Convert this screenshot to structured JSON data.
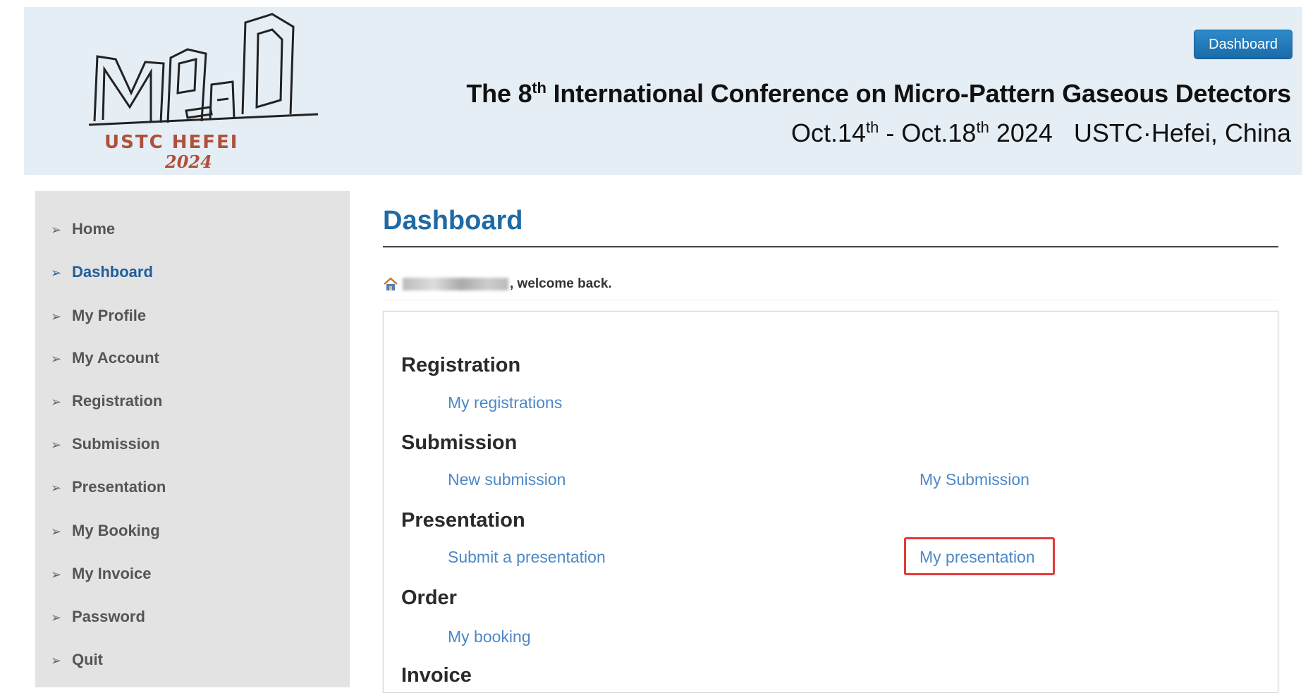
{
  "header": {
    "logo": {
      "letters": "MPGD",
      "place": "USTC HEFEI",
      "year": "2024"
    },
    "dashboard_button": "Dashboard",
    "title": {
      "pre": "The 8",
      "sup": "th",
      "post": " International Conference on Micro-Pattern Gaseous Detectors"
    },
    "dates": {
      "start": "Oct.14",
      "start_sup": "th",
      "sep": " - Oct.18",
      "end_sup": "th",
      "rest": " 2024   USTC·Hefei, China"
    }
  },
  "sidebar": {
    "items": [
      {
        "label": "Home"
      },
      {
        "label": "Dashboard",
        "active": true
      },
      {
        "label": "My Profile"
      },
      {
        "label": "My Account"
      },
      {
        "label": "Registration"
      },
      {
        "label": "Submission"
      },
      {
        "label": "Presentation"
      },
      {
        "label": "My Booking"
      },
      {
        "label": "My Invoice"
      },
      {
        "label": "Password"
      },
      {
        "label": "Quit"
      }
    ]
  },
  "main": {
    "title": "Dashboard",
    "welcome": ", welcome back.",
    "sections": {
      "registration": {
        "heading": "Registration",
        "links": [
          "My registrations"
        ]
      },
      "submission": {
        "heading": "Submission",
        "links": [
          "New submission",
          "My Submission"
        ]
      },
      "presentation": {
        "heading": "Presentation",
        "links": [
          "Submit a presentation",
          "My presentation"
        ]
      },
      "order": {
        "heading": "Order",
        "links": [
          "My booking"
        ]
      },
      "invoice": {
        "heading": "Invoice",
        "links": []
      }
    }
  },
  "colors": {
    "accent": "#1f6aa5",
    "link": "#4d88c6",
    "highlight": "#e23b3b",
    "banner": "#e6eef5",
    "sidebar": "#e3e3e3"
  },
  "icons": {
    "nav_arrow": "chevron-right-icon",
    "welcome": "home-icon"
  }
}
